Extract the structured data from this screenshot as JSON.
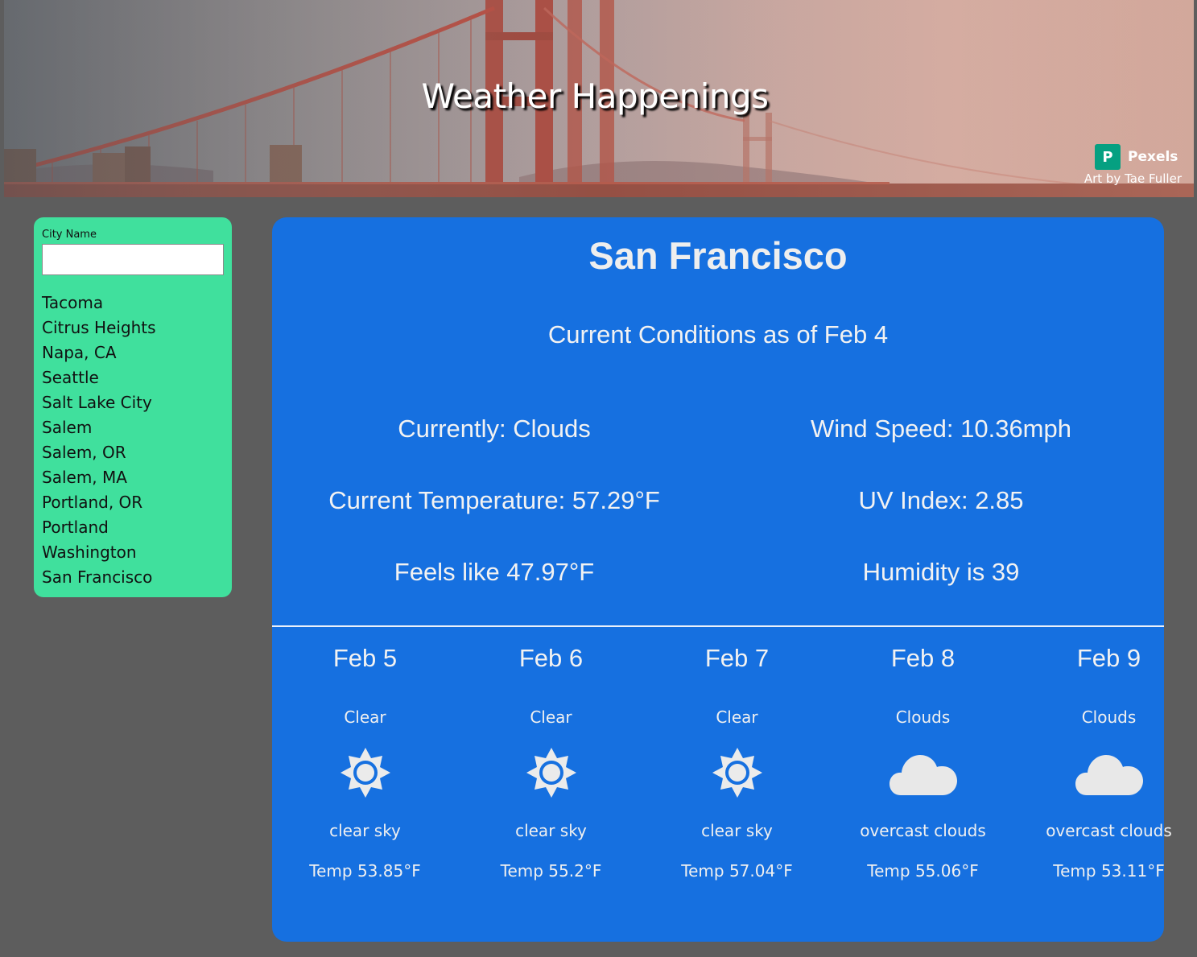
{
  "header": {
    "title": "Weather Happenings",
    "photo_source": "Pexels",
    "art_credit": "Art by Tae Fuller"
  },
  "sidebar": {
    "label": "City Name",
    "input_value": "",
    "cities": [
      "Tacoma",
      "Citrus Heights",
      "Napa, CA",
      "Seattle",
      "Salt Lake City",
      "Salem",
      "Salem, OR",
      "Salem, MA",
      "Portland, OR",
      "Portland",
      "Washington",
      "San Francisco"
    ]
  },
  "current": {
    "city": "San Francisco",
    "as_of": "Current Conditions as of Feb 4",
    "currently": "Currently: Clouds",
    "temperature": "Current Temperature: 57.29°F",
    "feels_like": "Feels like 47.97°F",
    "wind": "Wind Speed: 10.36mph",
    "uv": "UV Index: 2.85",
    "humidity": "Humidity is 39"
  },
  "forecast": [
    {
      "date": "Feb 5",
      "main": "Clear",
      "icon": "sun-icon",
      "desc": "clear sky",
      "temp": "Temp 53.85°F"
    },
    {
      "date": "Feb 6",
      "main": "Clear",
      "icon": "sun-icon",
      "desc": "clear sky",
      "temp": "Temp 55.2°F"
    },
    {
      "date": "Feb 7",
      "main": "Clear",
      "icon": "sun-icon",
      "desc": "clear sky",
      "temp": "Temp 57.04°F"
    },
    {
      "date": "Feb 8",
      "main": "Clouds",
      "icon": "cloud-icon",
      "desc": "overcast clouds",
      "temp": "Temp 55.06°F"
    },
    {
      "date": "Feb 9",
      "main": "Clouds",
      "icon": "cloud-icon",
      "desc": "overcast clouds",
      "temp": "Temp 53.11°F"
    }
  ],
  "colors": {
    "background": "#5d5d5d",
    "sidebar": "#40e09d",
    "panel": "#1670e0",
    "pexels_green": "#05a081"
  }
}
